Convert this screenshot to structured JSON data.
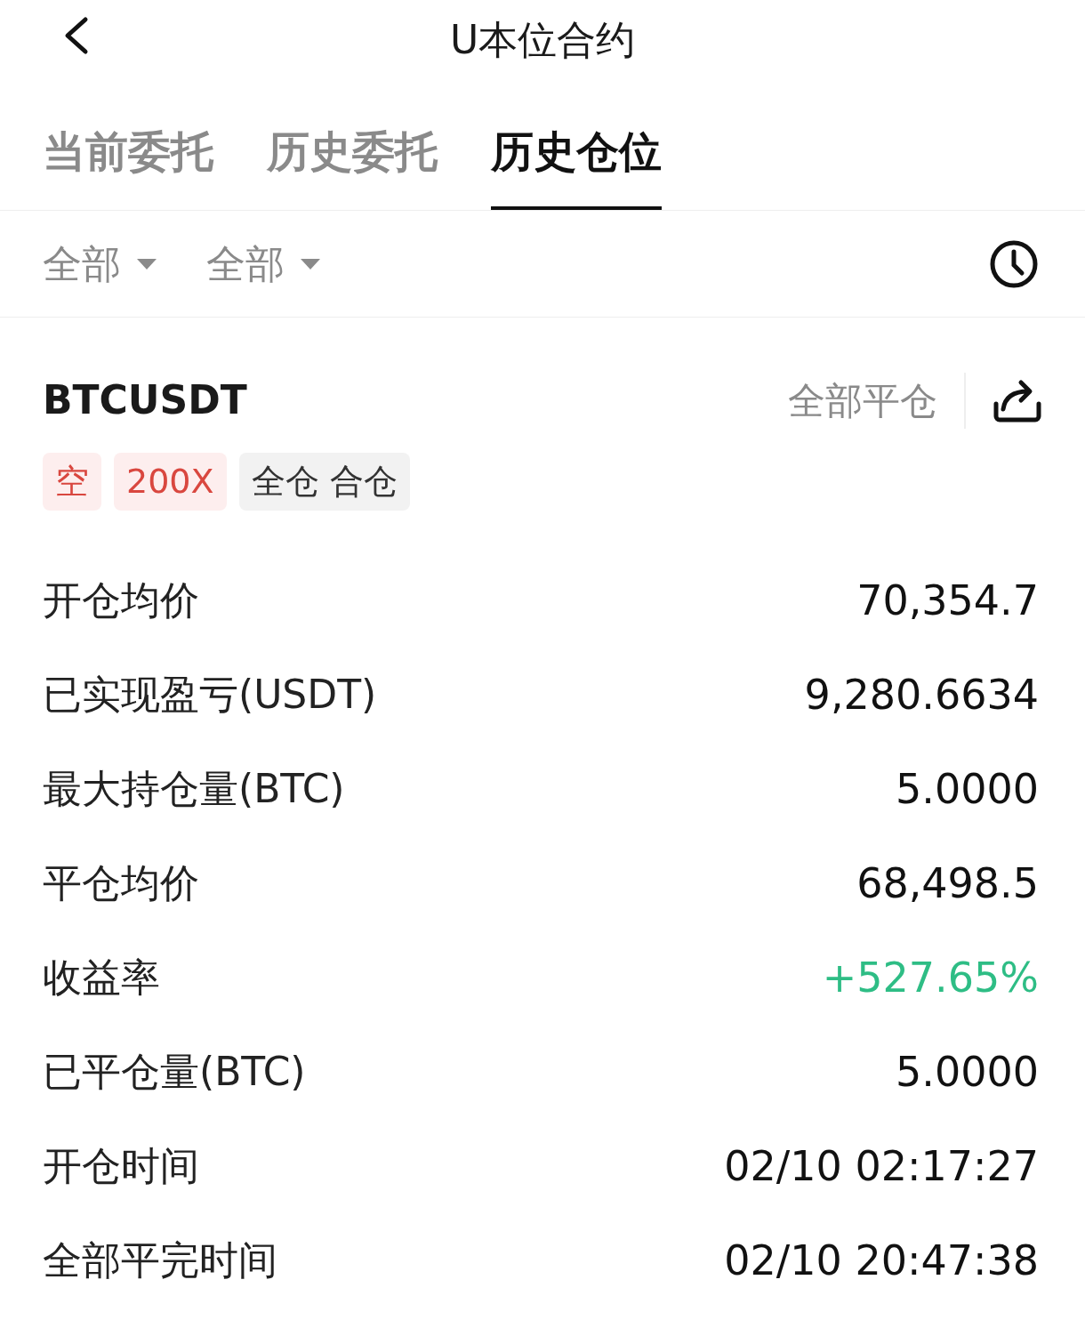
{
  "header": {
    "title": "U本位合约"
  },
  "tabs": [
    {
      "label": "当前委托",
      "selected": false
    },
    {
      "label": "历史委托",
      "selected": false
    },
    {
      "label": "历史仓位",
      "selected": true
    }
  ],
  "filters": [
    {
      "label": "全部"
    },
    {
      "label": "全部"
    }
  ],
  "position": {
    "symbol": "BTCUSDT",
    "close_all": "全部平仓",
    "tags": [
      {
        "label": "空",
        "kind": "alert"
      },
      {
        "label": "200X",
        "kind": "alert"
      },
      {
        "label": "全仓 合仓",
        "kind": "neutral"
      }
    ],
    "rows": [
      {
        "label": "开仓均价",
        "value": "70,354.7",
        "kind": "plain"
      },
      {
        "label": "已实现盈亏(USDT)",
        "value": "9,280.6634",
        "kind": "plain"
      },
      {
        "label": "最大持仓量(BTC)",
        "value": "5.0000",
        "kind": "plain"
      },
      {
        "label": "平仓均价",
        "value": "68,498.5",
        "kind": "plain"
      },
      {
        "label": "收益率",
        "value": "+527.65%",
        "kind": "gain"
      },
      {
        "label": "已平仓量(BTC)",
        "value": "5.0000",
        "kind": "plain"
      },
      {
        "label": "开仓时间",
        "value": "02/10 02:17:27",
        "kind": "plain"
      },
      {
        "label": "全部平完时间",
        "value": "02/10 20:47:38",
        "kind": "plain"
      }
    ]
  }
}
